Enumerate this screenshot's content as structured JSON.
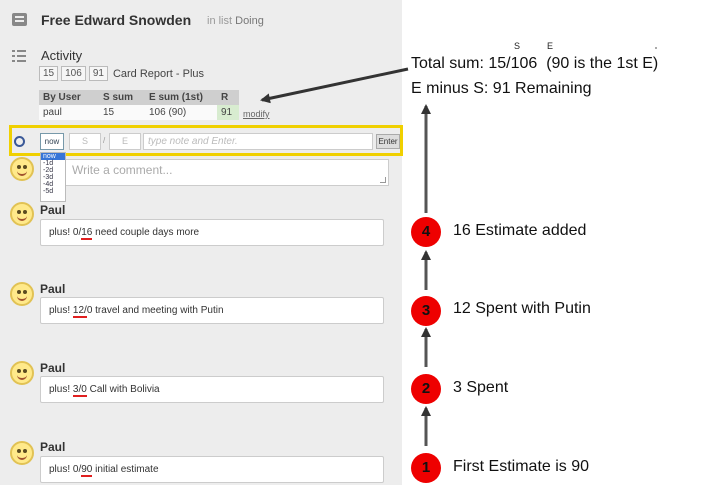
{
  "card": {
    "title": "Free Edward Snowden",
    "list_prefix": "in list",
    "list_name": "Doing"
  },
  "activity": {
    "title": "Activity",
    "badges": [
      "15",
      "106",
      "91"
    ],
    "report_label": "Card Report - Plus"
  },
  "summary_table": {
    "headers": [
      "By User",
      "S sum",
      "E sum (1st)",
      "R"
    ],
    "row": [
      "paul",
      "15",
      "106 (90)",
      "91"
    ],
    "modify_label": "modify"
  },
  "entry": {
    "now_label": "now",
    "s_placeholder": "S",
    "slash": "/",
    "e_placeholder": "E",
    "note_placeholder": "type note and Enter.",
    "enter_label": "Enter",
    "dropdown_options": [
      "now",
      "-1d",
      "-2d",
      "-3d",
      "-4d",
      "-5d"
    ]
  },
  "comment": {
    "placeholder": "Write a comment..."
  },
  "feed": [
    {
      "author": "Paul",
      "prefix": "plus!",
      "spent": "0",
      "estimate": "16",
      "note": "need couple days more",
      "underlined": "16"
    },
    {
      "author": "Paul",
      "prefix": "plus!",
      "spent": "12",
      "estimate": "0",
      "note": "travel and meeting with Putin",
      "underlined": "12/"
    },
    {
      "author": "Paul",
      "prefix": "plus!",
      "spent": "3",
      "estimate": "0",
      "note": "Call with Bolivia",
      "underlined": "3/0"
    },
    {
      "author": "Paul",
      "prefix": "plus!",
      "spent": "0",
      "estimate": "90",
      "note": "initial estimate",
      "underlined": "90"
    }
  ],
  "annotations": {
    "total_prefix": "Total sum:",
    "total_value": "15/106",
    "total_note": "(90 is the 1st  E)",
    "sup_s": "S",
    "sup_e": "E",
    "remaining": "E minus S: 91  Remaining",
    "steps": [
      {
        "number": "4",
        "text": "16  Estimate added"
      },
      {
        "number": "3",
        "text": "12 Spent with Putin"
      },
      {
        "number": "2",
        "text": "3 Spent"
      },
      {
        "number": "1",
        "text": "First  Estimate is 90"
      }
    ]
  },
  "colors": {
    "highlight_box": "#f0d000",
    "step_circle": "#ee0000",
    "underline": "#e02020",
    "remaining_cell": "#d8ecd0"
  }
}
